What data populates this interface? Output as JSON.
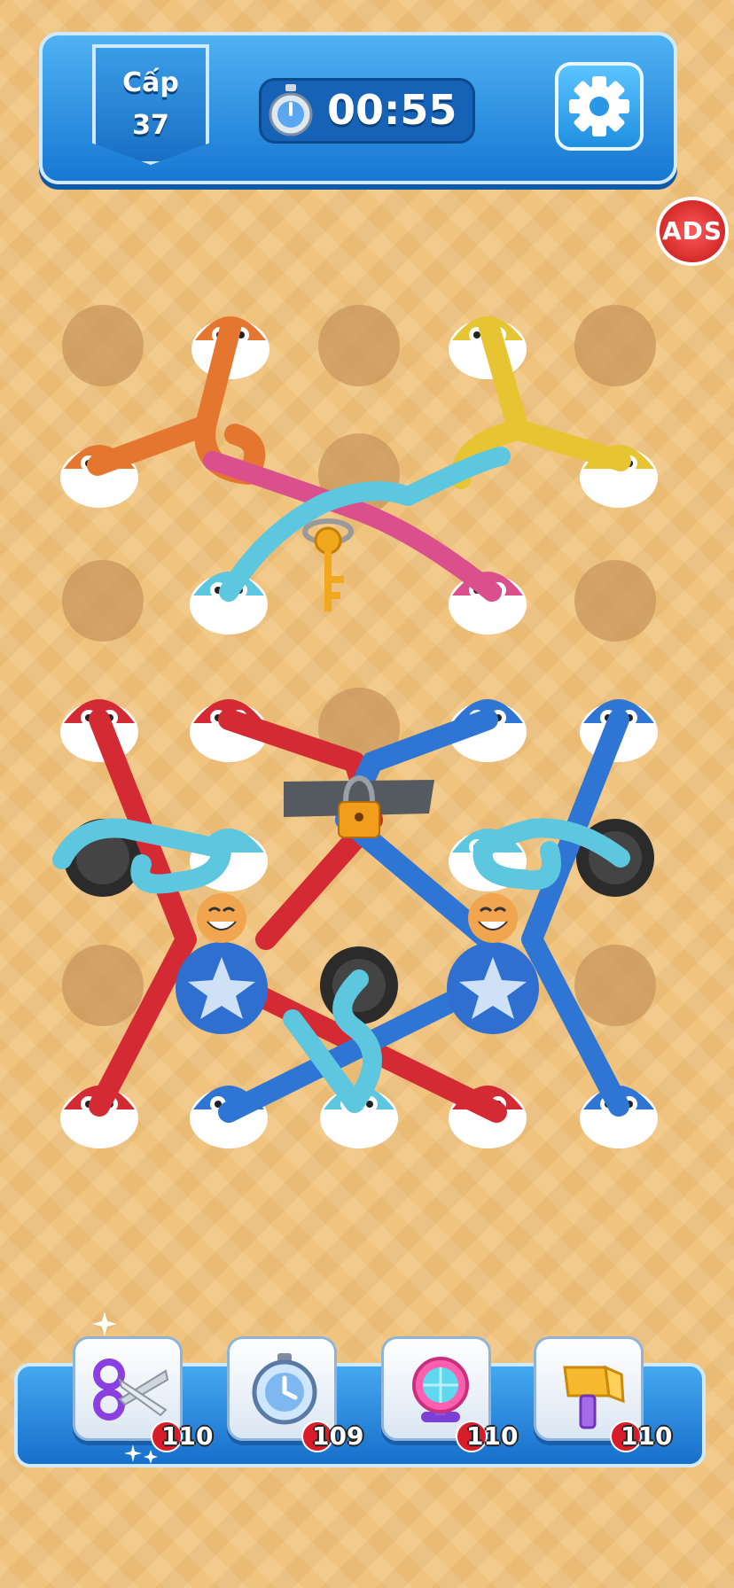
{
  "header": {
    "level_label": "Cấp",
    "level_number": "37",
    "timer": "00:55"
  },
  "ads_badge": "ADS",
  "colors": {
    "orange_rope": "#e5762f",
    "yellow_rope": "#e7c532",
    "pink_rope": "#d9508d",
    "cyan_rope": "#5cc7df",
    "red_rope": "#d32a34",
    "blue_rope": "#2f76d4"
  },
  "tools": [
    {
      "name": "scissors-icon",
      "count": "110"
    },
    {
      "name": "stopwatch-icon",
      "count": "109"
    },
    {
      "name": "fan-icon",
      "count": "110"
    },
    {
      "name": "hammer-icon",
      "count": "110"
    }
  ]
}
